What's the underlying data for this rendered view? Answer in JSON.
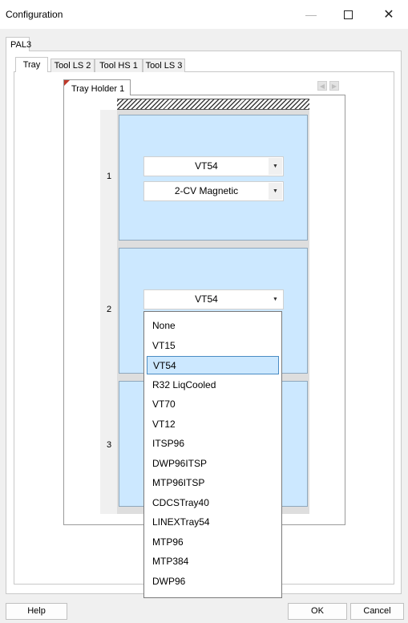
{
  "window": {
    "title": "Configuration"
  },
  "outer_tab": "PAL3",
  "inner_tabs": [
    "Tray",
    "Tool LS 2",
    "Tool HS 1",
    "Tool LS 3"
  ],
  "tray_holder_tab": "Tray Holder 1",
  "slots": [
    {
      "number": "1",
      "tray_type": "VT54",
      "tray_config": "2-CV Magnetic"
    },
    {
      "number": "2",
      "tray_type": "VT54"
    },
    {
      "number": "3"
    }
  ],
  "dropdown": {
    "options": [
      "None",
      "VT15",
      "VT54",
      "R32 LiqCooled",
      "VT70",
      "VT12",
      "ITSP96",
      "DWP96ITSP",
      "MTP96ITSP",
      "CDCSTray40",
      "LINEXTray54",
      "MTP96",
      "MTP384",
      "DWP96"
    ],
    "selected_index": 2
  },
  "buttons": {
    "help": "Help",
    "ok": "OK",
    "cancel": "Cancel"
  },
  "icons": {
    "minimize": "minimize-icon",
    "maximize": "maximize-icon",
    "close": "close-icon",
    "dropdown_arrow": "chevron-down-icon"
  },
  "colors": {
    "slot_fill": "#cce8ff",
    "selection_border": "#4a8cc4",
    "tab_marker": "#c0392b"
  }
}
